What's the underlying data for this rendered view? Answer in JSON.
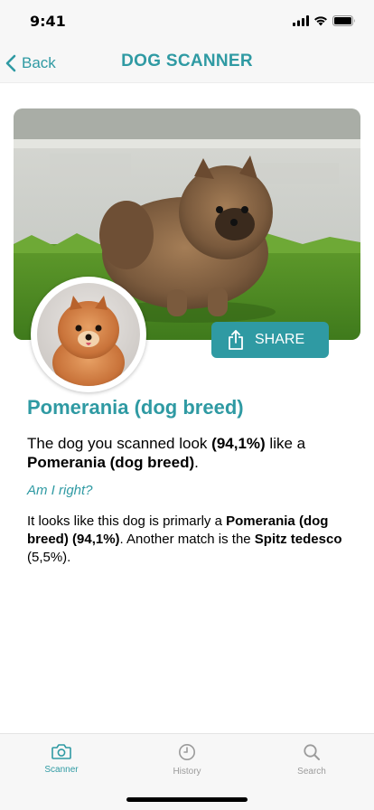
{
  "status_bar": {
    "time": "9:41"
  },
  "nav": {
    "back_label": "Back",
    "title": "DOG SCANNER"
  },
  "share": {
    "label": "SHARE"
  },
  "result": {
    "breed_title": "Pomerania (dog breed)",
    "line_prefix": "The dog you scanned look ",
    "line_pct": "(94,1%)",
    "line_mid": " like a ",
    "line_breed": "Pomerania (dog breed)",
    "line_end": ".",
    "question": "Am I right?",
    "detail_prefix": "It looks like this dog is primarly a ",
    "detail_breed": "Pomerania (dog breed)",
    "detail_pct": " (94,1%)",
    "detail_mid": ". Another match is the ",
    "detail_alt": "Spitz tedesco",
    "detail_alt_pct": " (5,5%).",
    "accent_color": "#2f9aa3"
  },
  "tabs": [
    {
      "label": "Scanner",
      "icon": "camera-icon",
      "active": true
    },
    {
      "label": "History",
      "icon": "clock-icon",
      "active": false
    },
    {
      "label": "Search",
      "icon": "search-icon",
      "active": false
    }
  ]
}
